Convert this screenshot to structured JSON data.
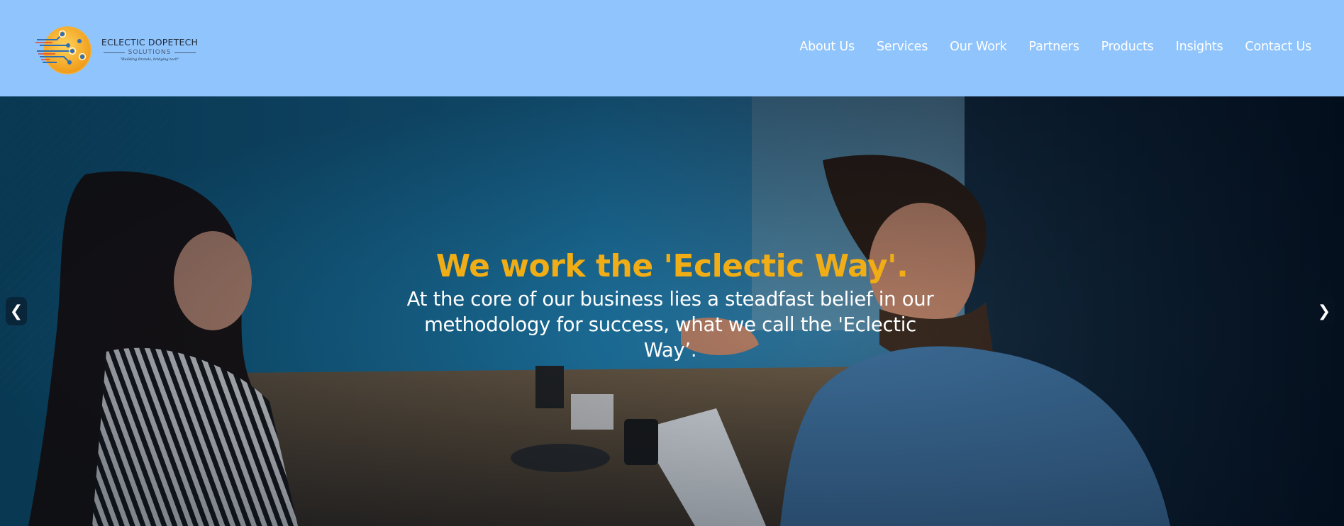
{
  "brand": {
    "name": "ECLECTIC DOPETECH",
    "sub": "SOLUTIONS",
    "tagline": "\"Building Brands, bridging tech\""
  },
  "nav": {
    "items": [
      {
        "label": "About Us"
      },
      {
        "label": "Services"
      },
      {
        "label": "Our Work"
      },
      {
        "label": "Partners"
      },
      {
        "label": "Products"
      },
      {
        "label": "Insights"
      },
      {
        "label": "Contact Us"
      }
    ]
  },
  "hero": {
    "title": "We work the 'Eclectic Way'.",
    "text": "At the core of our business lies a steadfast belief in our methodology for success, what we call the 'Eclectic Way’.",
    "prev_icon": "❮",
    "next_icon": "❯"
  },
  "colors": {
    "header_bg": "#90c4fc",
    "title_accent": "#f0ad16",
    "nav_text": "#ffffff"
  }
}
